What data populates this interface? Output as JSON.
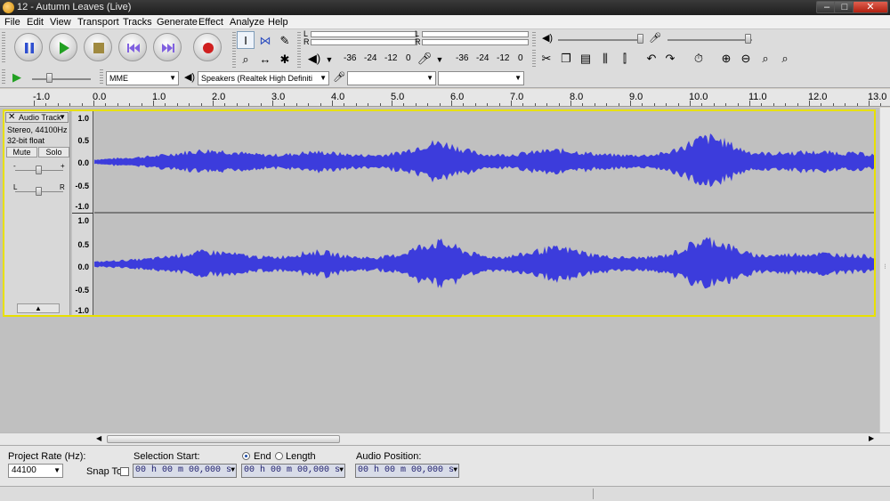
{
  "window": {
    "title": "12 - Autumn Leaves (Live)",
    "minimize": "–",
    "maximize": "□",
    "close": "✕"
  },
  "menu": [
    "File",
    "Edit",
    "View",
    "Transport",
    "Tracks",
    "Generate",
    "Effect",
    "Analyze",
    "Help"
  ],
  "meters": {
    "playback": {
      "l": "L",
      "r": "R",
      "scale": [
        "-36",
        "-24",
        "-12",
        "0"
      ]
    },
    "record": {
      "l": "L",
      "r": "R",
      "scale": [
        "-36",
        "-24",
        "-12",
        "0"
      ]
    }
  },
  "device": {
    "host": "MME",
    "output": "Speakers (Realtek High Definiti",
    "input": "",
    "channels": ""
  },
  "ruler": [
    "-1.0",
    "0.0",
    "1.0",
    "2.0",
    "3.0",
    "4.0",
    "5.0",
    "6.0",
    "7.0",
    "8.0",
    "9.0",
    "10.0",
    "11.0",
    "12.0",
    "13.0"
  ],
  "track": {
    "name": "Audio Track",
    "info_rate": "Stereo, 44100Hz",
    "info_format": "32-bit float",
    "mute": "Mute",
    "solo": "Solo",
    "gain_minus": "-",
    "gain_plus": "+",
    "pan_l": "L",
    "pan_r": "R",
    "scale": [
      "1.0",
      "0.5",
      "0.0",
      "-0.5",
      "-1.0"
    ],
    "wave_color": "#3c3cdc"
  },
  "selection": {
    "project_rate_label": "Project Rate (Hz):",
    "project_rate": "44100",
    "snap_to": "Snap To",
    "selection_start_label": "Selection Start:",
    "end_label": "End",
    "length_label": "Length",
    "audio_position_label": "Audio Position:",
    "start_time": "00 h 00 m 00,000 s",
    "end_time": "00 h 00 m 00,000 s",
    "position_time": "00 h 00 m 00,000 s"
  },
  "colors": {
    "selection_border": "#e8e000",
    "background": "#c0c0c0"
  }
}
